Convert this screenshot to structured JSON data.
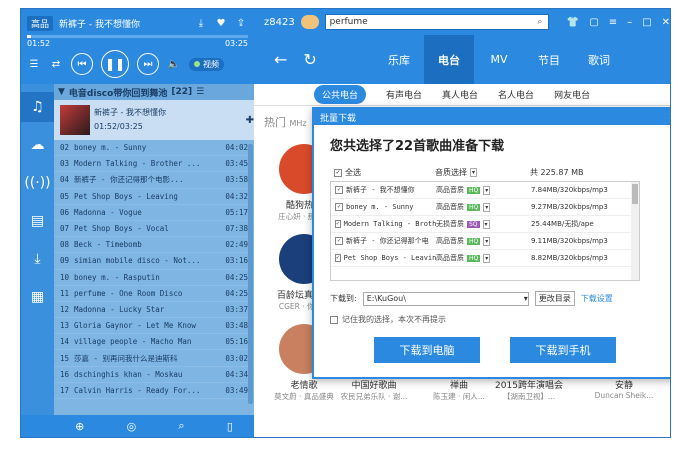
{
  "player": {
    "quality": "高品",
    "song": "新裤子 - 我不想懂你",
    "progress": 0.02,
    "time_current": "01:52",
    "time_total": "03:25",
    "mv_label": "视频"
  },
  "topbar": {
    "user": "z8423",
    "search_value": "perfume"
  },
  "nav": {
    "tabs": [
      "乐库",
      "电台",
      "MV",
      "节目",
      "歌词"
    ],
    "active_index": 1
  },
  "playlist": {
    "title": "电音disco带你回到舞池",
    "count": "[22]",
    "current_title": "新裤子 - 我不想懂你",
    "current_time": "01:52/03:25",
    "rows": [
      {
        "n": "02",
        "t": "boney m. - Sunny",
        "d": "04:02"
      },
      {
        "n": "03",
        "t": "Modern Talking - Brother ...",
        "d": "03:45"
      },
      {
        "n": "04",
        "t": "新裤子 - 你还记得那个电影...",
        "d": "03:58"
      },
      {
        "n": "05",
        "t": "Pet Shop Boys - Leaving",
        "d": "04:32"
      },
      {
        "n": "06",
        "t": "Madonna - Vogue",
        "d": "05:17"
      },
      {
        "n": "07",
        "t": "Pet Shop Boys - Vocal",
        "d": "07:38"
      },
      {
        "n": "08",
        "t": "Beck - Timebomb",
        "d": "02:49"
      },
      {
        "n": "09",
        "t": "simian mobile disco - Not...",
        "d": "03:16"
      },
      {
        "n": "10",
        "t": "boney m. - Rasputin",
        "d": "04:25"
      },
      {
        "n": "11",
        "t": "perfume - One Room Disco",
        "d": "04:25"
      },
      {
        "n": "12",
        "t": "Madonna - Lucky Star",
        "d": "03:37"
      },
      {
        "n": "13",
        "t": "Gloria Gaynor - Let Me Know",
        "d": "03:48"
      },
      {
        "n": "14",
        "t": "village people - Macho Man",
        "d": "05:16"
      },
      {
        "n": "15",
        "t": "莎嘉 - 别再问我什么是迪斯科",
        "d": "03:02"
      },
      {
        "n": "16",
        "t": "dschinghis khan - Moskau",
        "d": "04:34"
      },
      {
        "n": "17",
        "t": "Calvin Harris - Ready For...",
        "d": "03:49"
      }
    ]
  },
  "content": {
    "subtabs": [
      "公共电台",
      "有声电台",
      "真人电台",
      "名人电台",
      "网友电台"
    ],
    "hot_label": "热门",
    "hot_sub": "MHz",
    "cards": [
      {
        "title": "酷狗热歌",
        "sub": "庄心妍 · 那一..."
      },
      {
        "title": "百龄坛真音乐",
        "sub": "CGER · 你要..."
      },
      {
        "title": "老情歌",
        "sub": "莫文蔚 · 真品盛典"
      },
      {
        "title": "中国好歌曲",
        "sub": "农民兄弟乐队 · 谢..."
      },
      {
        "title": "禅曲",
        "sub": "陈玉建 · 闲人..."
      },
      {
        "title": "2015跨年演唱会",
        "sub": "【湖南卫视】..."
      },
      {
        "title": "安静",
        "sub": "Duncan Sheik..."
      }
    ]
  },
  "dialog": {
    "title": "批量下载",
    "headline": "您共选择了22首歌曲准备下载",
    "select_all": "全选",
    "quality_header": "音质选择",
    "total": "共 225.87 MB",
    "rows": [
      {
        "name": "新裤子 - 我不想懂你",
        "q": "高品音质",
        "badge": "HQ",
        "info": "7.84MB/320kbps/mp3"
      },
      {
        "name": "boney m. - Sunny",
        "q": "高品音质",
        "badge": "HQ",
        "info": "9.27MB/320kbps/mp3"
      },
      {
        "name": "Modern Talking - Brothe",
        "q": "无损音质",
        "badge": "SQ",
        "info": "25.44MB/无损/ape"
      },
      {
        "name": "新裤子 - 你还记得那个电",
        "q": "高品音质",
        "badge": "HQ",
        "info": "9.11MB/320kbps/mp3"
      },
      {
        "name": "Pet Shop Boys - Leaving",
        "q": "高品音质",
        "badge": "HQ",
        "info": "8.82MB/320kbps/mp3"
      }
    ],
    "download_to_label": "下载到:",
    "path": "E:\\KuGou\\",
    "change_dir": "更改目录",
    "settings_link": "下载设置",
    "remember": "记住我的选择，本次不再提示",
    "btn_pc": "下载到电脑",
    "btn_phone": "下载到手机"
  }
}
